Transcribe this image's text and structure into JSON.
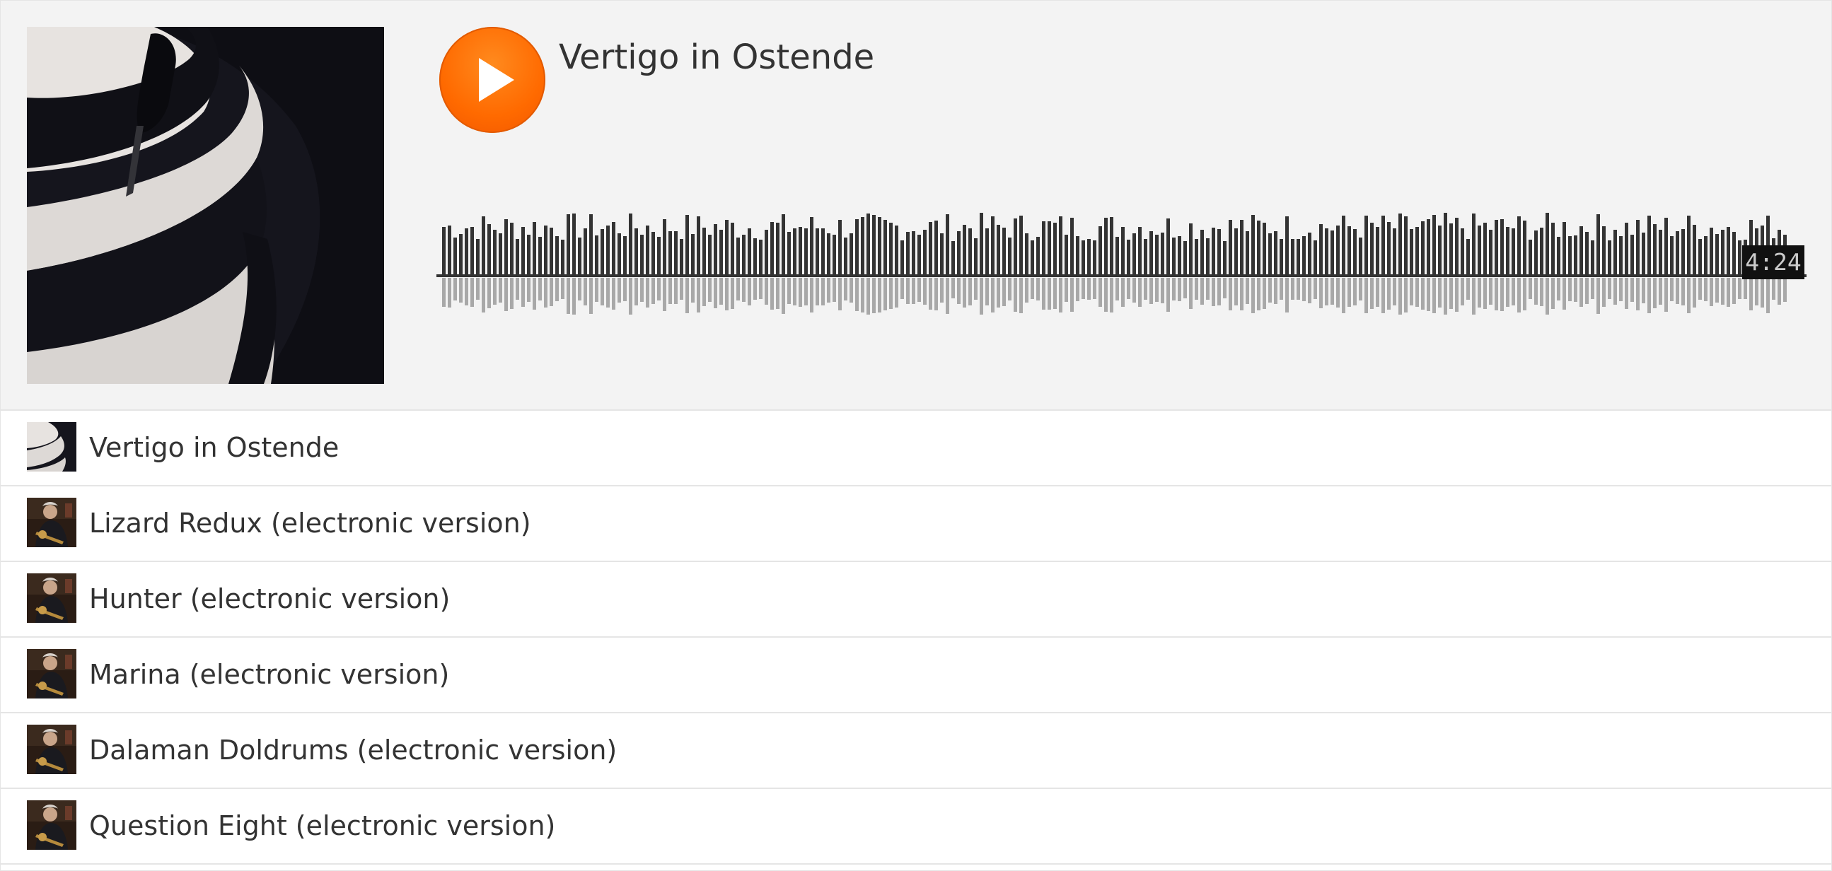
{
  "player": {
    "title": "Vertigo in Ostende",
    "duration": "4:24",
    "play_icon": "play-icon",
    "accent_color": "#ff6a00",
    "waveform_color": "#333333",
    "waveform_reflection_color": "#a8a8a8"
  },
  "tracks": [
    {
      "title": "Vertigo in Ostende",
      "art": "spiral-stairs"
    },
    {
      "title": "Lizard Redux  (electronic version)",
      "art": "musician"
    },
    {
      "title": "Hunter  (electronic version)",
      "art": "musician"
    },
    {
      "title": "Marina  (electronic version)",
      "art": "musician"
    },
    {
      "title": "Dalaman Doldrums  (electronic version)",
      "art": "musician"
    },
    {
      "title": "Question Eight  (electronic version)",
      "art": "musician"
    }
  ]
}
